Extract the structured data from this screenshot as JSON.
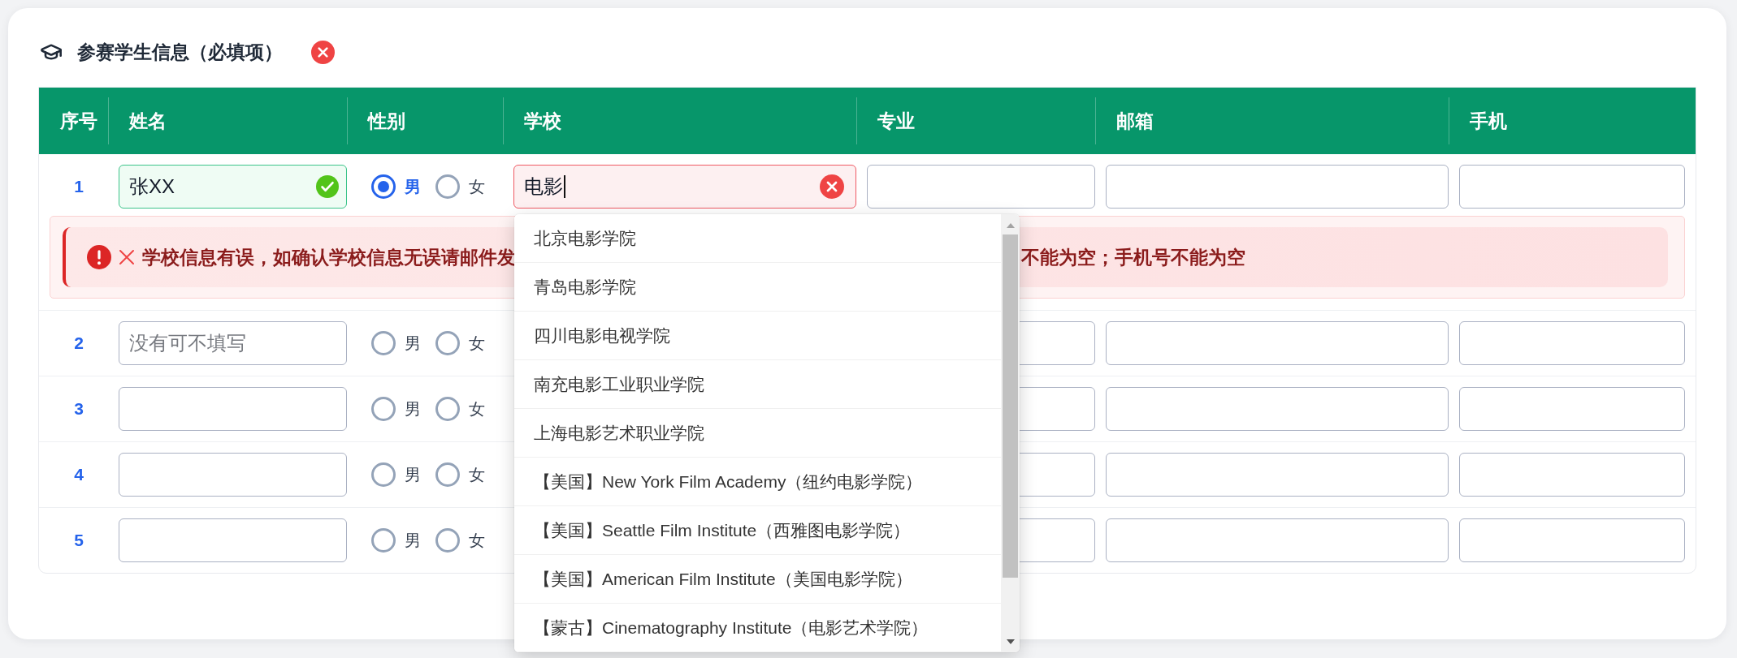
{
  "section": {
    "title": "参赛学生信息（必填项）",
    "valid": false
  },
  "table": {
    "columns": [
      "序号",
      "姓名",
      "性别",
      "学校",
      "专业",
      "邮箱",
      "手机"
    ],
    "rows": [
      {
        "number": "1",
        "name": {
          "value": "张XX",
          "valid": true
        },
        "gender": [
          {
            "label": "男",
            "selected": true
          },
          {
            "label": "女",
            "selected": false
          }
        ],
        "school": {
          "value": "电影",
          "valid": false,
          "focused": true,
          "suggestions": [
            {
              "label": "北京电影学院",
              "selected": false
            },
            {
              "label": "青岛电影学院",
              "selected": false
            },
            {
              "label": "四川电影电视学院",
              "selected": false
            },
            {
              "label": "南充电影工业职业学院",
              "selected": false
            },
            {
              "label": "上海电影艺术职业学院",
              "selected": false
            },
            {
              "label": "【美国】New York Film Academy（纽约电影学院）",
              "selected": false
            },
            {
              "label": "【美国】Seattle Film Institute（西雅图电影学院）",
              "selected": false
            },
            {
              "label": "【美国】American Film Institute（美国电影学院）",
              "selected": false
            },
            {
              "label": "【蒙古】Cinematography Institute（电影艺术学院）",
              "selected": false
            }
          ]
        },
        "major": {},
        "email": {},
        "phone": {},
        "error": {
          "texts": [
            "学校信息有误，如确认学校信息无误请邮件发",
            "不能为空；手机号不能为空"
          ]
        }
      },
      {
        "number": "2",
        "name": {
          "placeholder": "没有可不填写"
        },
        "gender": [
          {
            "label": "男",
            "selected": false
          },
          {
            "label": "女",
            "selected": false
          }
        ],
        "major": {},
        "email": {},
        "phone": {}
      },
      {
        "number": "3",
        "name": {},
        "gender": [
          {
            "label": "男",
            "selected": false
          },
          {
            "label": "女",
            "selected": false
          }
        ],
        "major": {},
        "email": {},
        "phone": {}
      },
      {
        "number": "4",
        "name": {},
        "gender": [
          {
            "label": "男",
            "selected": false
          },
          {
            "label": "女",
            "selected": false
          }
        ],
        "major": {},
        "email": {},
        "phone": {}
      },
      {
        "number": "5",
        "name": {},
        "gender": [
          {
            "label": "男",
            "selected": false
          },
          {
            "label": "女",
            "selected": false
          }
        ],
        "major": {},
        "email": {},
        "phone": {}
      }
    ]
  }
}
